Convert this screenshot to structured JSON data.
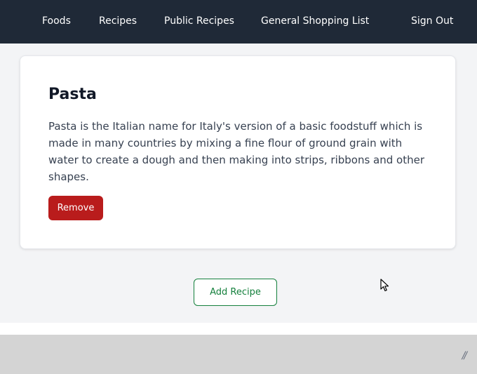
{
  "nav": {
    "foods": "Foods",
    "recipes": "Recipes",
    "public_recipes": "Public Recipes",
    "shopping_list": "General Shopping List",
    "sign_out": "Sign Out"
  },
  "recipe": {
    "title": "Pasta",
    "description": "Pasta is the Italian name for Italy's version of a basic foodstuff which is made in many countries by mixing a fine flour of ground grain with water to create a dough and then making into strips, ribbons and other shapes.",
    "remove_label": "Remove"
  },
  "actions": {
    "add_recipe_label": "Add Recipe"
  },
  "footer": {
    "grip": "//"
  },
  "colors": {
    "navbar": "#1f2937",
    "danger": "#b91c1c",
    "success": "#15803d",
    "background": "#f3f4f6"
  },
  "icons": {
    "cursor": "mouse-pointer-icon"
  }
}
